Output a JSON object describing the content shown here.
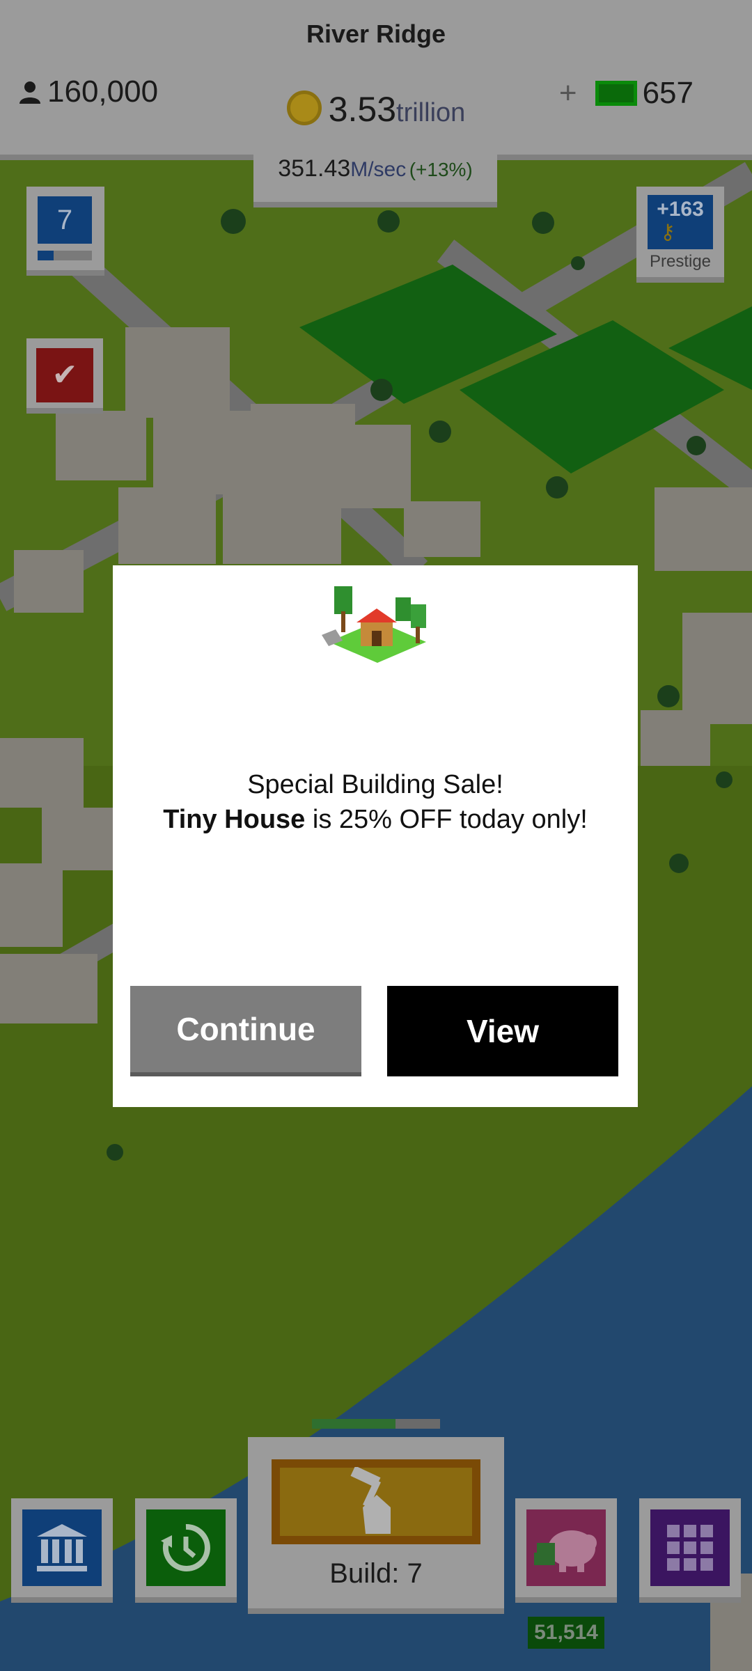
{
  "hud": {
    "city_name": "River Ridge",
    "population": "160,000",
    "money_total_number": "3.53",
    "money_total_unit": "trillion",
    "income_number": "351.43",
    "income_unit": "M/sec",
    "income_change": "(+13%)",
    "gems_plus": "+",
    "gems": "657"
  },
  "widgets": {
    "level": "7",
    "level_progress": 0.3,
    "prestige_amount": "+163",
    "prestige_label": "Prestige"
  },
  "toolbar": {
    "build_label": "Build: 7",
    "build_progress": 0.65,
    "piggy_value": "51,514"
  },
  "modal": {
    "line1": "Special Building Sale!",
    "building_name": "Tiny House",
    "line2_rest": " is 25% OFF today only!",
    "continue_label": "Continue",
    "view_label": "View"
  },
  "colors": {
    "view_button": "#000000",
    "continue_button": "#7d7d7d"
  }
}
